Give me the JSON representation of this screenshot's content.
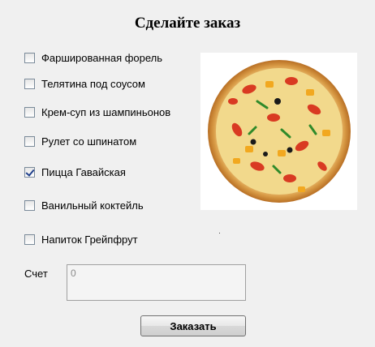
{
  "form": {
    "title": "Сделайте заказ",
    "items": [
      {
        "label": "Фаршированная форель",
        "checked": false
      },
      {
        "label": "Телятина под соусом",
        "checked": false
      },
      {
        "label": "Крем-суп из шампиньонов",
        "checked": false
      },
      {
        "label": "Рулет со шпинатом",
        "checked": false
      },
      {
        "label": "Пицца Гавайская",
        "checked": true
      },
      {
        "label": "Ванильный коктейль",
        "checked": false
      },
      {
        "label": "Напиток Грейпфрут",
        "checked": false
      }
    ],
    "score_label": "Счет",
    "score_value": "0",
    "order_button": "Заказать"
  },
  "image": {
    "icon": "pizza-image"
  }
}
